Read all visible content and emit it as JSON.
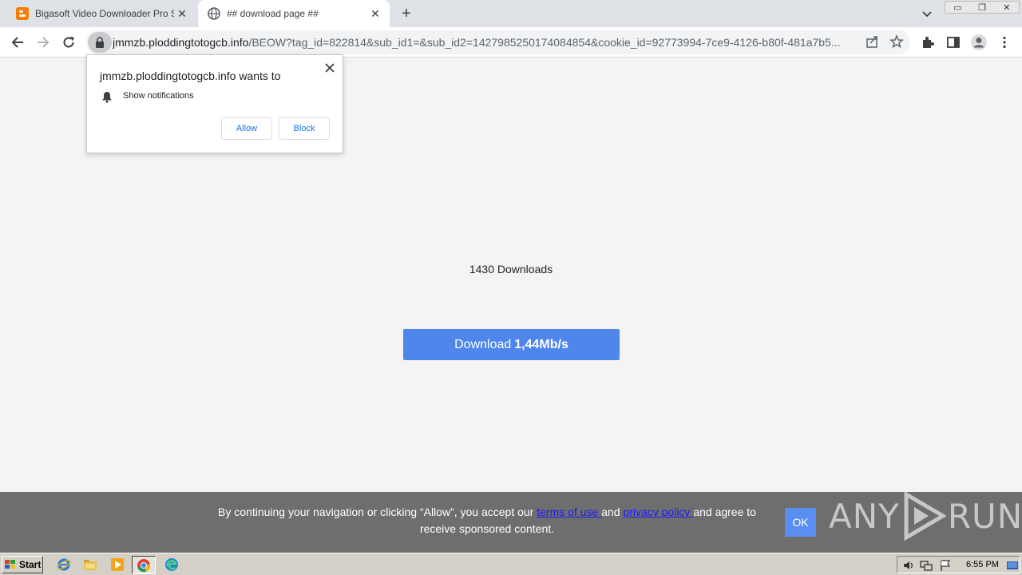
{
  "browser": {
    "tabs": [
      {
        "title": "Bigasoft Video Downloader Pro Serial",
        "close": "✕"
      },
      {
        "title": "## download page ##",
        "close": "✕"
      }
    ],
    "new_tab": "+",
    "address": {
      "host": "jmmzb.ploddingtotogcb.info",
      "path": "/BEOW?tag_id=822814&sub_id1=&sub_id2=1427985250174084854&cookie_id=92773994-7ce9-4126-b80f-481a7b5..."
    }
  },
  "notification_prompt": {
    "title": "jmmzb.ploddingtotogcb.info wants to",
    "permission": "Show notifications",
    "allow_label": "Allow",
    "block_label": "Block"
  },
  "page": {
    "downloads_text": "1430 Downloads",
    "download_button_prefix": "Download",
    "download_button_speed": "1,44Mb/s"
  },
  "consent": {
    "text_before": "By continuing your navigation or clicking “Allow”, you accept our ",
    "terms_link": "terms of use ",
    "text_mid": "and ",
    "privacy_link": "privacy policy ",
    "text_after": "and agree to receive sponsored content.",
    "ok_label": "OK"
  },
  "watermark": {
    "left": "ANY",
    "right": "RUN"
  },
  "taskbar": {
    "start_label": "Start",
    "clock": "6:55 PM"
  },
  "colors": {
    "download_button": "#4f86ec",
    "consent_bar": "#6e6e6e",
    "link": "#1a1aff",
    "ok_button": "#5a8ef0"
  }
}
